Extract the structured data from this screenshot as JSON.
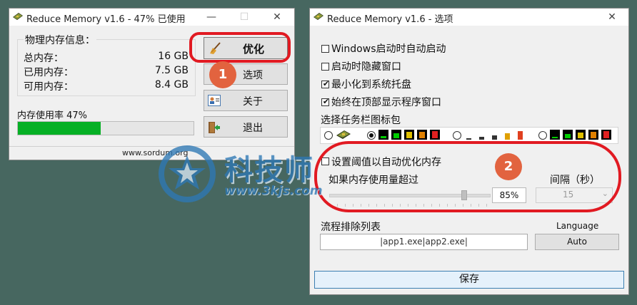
{
  "window1": {
    "title": "Reduce Memory v1.6 - 47% 已使用",
    "info_group_title": "物理内存信息：",
    "rows": [
      {
        "label": "总内存：",
        "value": "16 GB"
      },
      {
        "label": "已用内存：",
        "value": "7.5 GB"
      },
      {
        "label": "可用内存：",
        "value": "8.4 GB"
      }
    ],
    "usage_label": "内存使用率 47%",
    "usage_percent": 47,
    "buttons": {
      "optimize": "优化",
      "options": "选项",
      "about": "关于",
      "exit": "退出"
    },
    "footer_link": "www.sordum.org"
  },
  "window2": {
    "title": "Reduce Memory v1.6 - 选项",
    "checkboxes": [
      {
        "label": "Windows启动时自动启动",
        "checked": false
      },
      {
        "label": "启动时隐藏窗口",
        "checked": false
      },
      {
        "label": "最小化到系统托盘",
        "checked": true
      },
      {
        "label": "始终在顶部显示程序窗口",
        "checked": true
      }
    ],
    "icon_pack_label": "选择任务栏图标包",
    "icon_pack_selected": 1,
    "threshold_checkbox_label": "设置阈值以自动优化内存",
    "threshold_checked": false,
    "memory_over_label": "如果内存使用量超过",
    "threshold_value": "85%",
    "threshold_slider_percent": 85,
    "interval_label": "间隔（秒）",
    "interval_value": "15",
    "exclusion_label": "流程排除列表",
    "exclusion_value": "|app1.exe|app2.exe|",
    "language_label": "Language",
    "language_value": "Auto",
    "save_button": "保存"
  },
  "annotations": {
    "badge1": "1",
    "badge2": "2",
    "ring_color": "#e11a22",
    "badge_color": "#e2633f"
  },
  "watermark": {
    "text": "科技师",
    "url": "www.3kjs.com"
  },
  "colors": {
    "progress": "#06b025",
    "desktop": "#476760"
  }
}
